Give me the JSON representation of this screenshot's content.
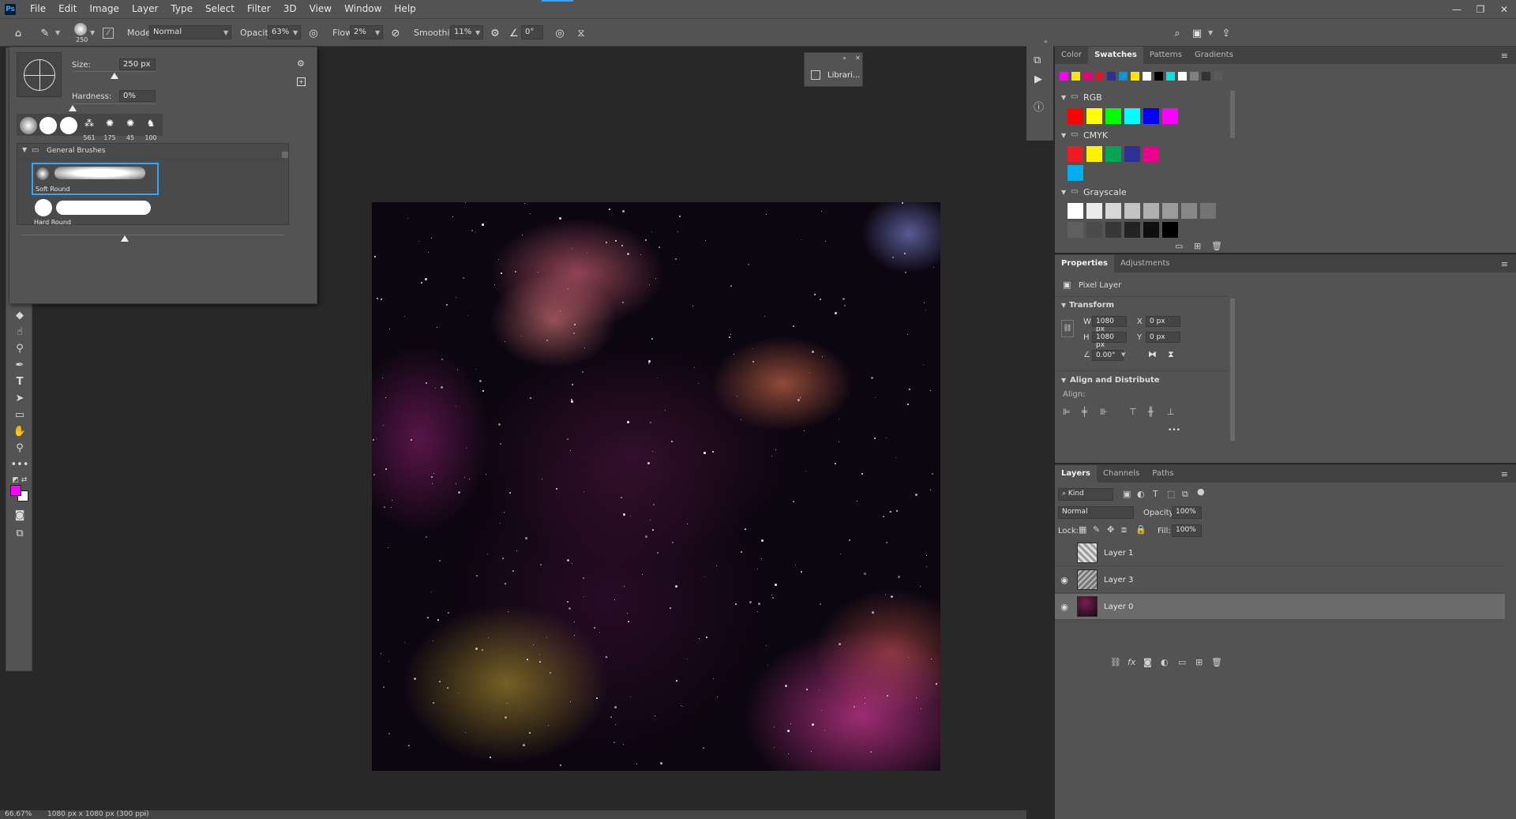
{
  "app": {
    "logo": "Ps"
  },
  "menu": [
    "File",
    "Edit",
    "Image",
    "Layer",
    "Type",
    "Select",
    "Filter",
    "3D",
    "View",
    "Window",
    "Help"
  ],
  "window_controls": {
    "minimize": "—",
    "restore": "❐",
    "close": "✕"
  },
  "options": {
    "brush_size": "250",
    "mode_label": "Mode:",
    "mode_value": "Normal",
    "opacity_label": "Opacity:",
    "opacity_value": "63%",
    "flow_label": "Flow:",
    "flow_value": "2%",
    "smoothing_label": "Smoothing:",
    "smoothing_value": "11%",
    "angle_value": "0°"
  },
  "brush_popup": {
    "size_label": "Size:",
    "size_value": "250 px",
    "size_fraction": 0.5,
    "hardness_label": "Hardness:",
    "hardness_value": "0%",
    "hardness_fraction": 0.0,
    "recent_presets": [
      "",
      "",
      "",
      "561",
      "175",
      "45",
      "100"
    ],
    "group_name": "General Brushes",
    "brushes": [
      {
        "name": "Soft Round",
        "selected": true
      },
      {
        "name": "Hard Round",
        "selected": false
      }
    ]
  },
  "libraries": {
    "label": "Librari..."
  },
  "swatches_panel": {
    "tabs": [
      "Color",
      "Swatches",
      "Patterns",
      "Gradients"
    ],
    "active_tab": "Swatches",
    "recent": [
      "#ff00ff",
      "#ffe600",
      "#e6007e",
      "#e0142a",
      "#2e3192",
      "#0098da",
      "#ffe600",
      "#ffffff",
      "#000000",
      "#00e6e6",
      "#ffffff",
      "#808080",
      "#333333",
      "#5a5a5a"
    ],
    "groups": [
      {
        "name": "RGB",
        "colors": [
          "#ff0000",
          "#ffff00",
          "#00ff00",
          "#00ffff",
          "#0000ff",
          "#ff00ff"
        ]
      },
      {
        "name": "CMYK",
        "colors": [
          "#ed1c24",
          "#fff200",
          "#00a651",
          "#2e3192",
          "#ec008c",
          "#00aeef"
        ]
      },
      {
        "name": "Grayscale",
        "colors": [
          "#ffffff",
          "#ebebeb",
          "#d7d7d7",
          "#c3c3c3",
          "#afafaf",
          "#9b9b9b",
          "#878787",
          "#737373",
          "#5f5f5f",
          "#4b4b4b",
          "#373737",
          "#232323",
          "#0f0f0f",
          "#000000"
        ]
      }
    ]
  },
  "properties_panel": {
    "tabs": [
      "Properties",
      "Adjustments"
    ],
    "active_tab": "Properties",
    "layer_type": "Pixel Layer",
    "transform_title": "Transform",
    "w_label": "W",
    "w_value": "1080 px",
    "h_label": "H",
    "h_value": "1080 px",
    "x_label": "X",
    "x_value": "0 px",
    "y_label": "Y",
    "y_value": "0 px",
    "angle_value": "0.00°",
    "align_title": "Align and Distribute",
    "align_label": "Align:",
    "more": "•••"
  },
  "layers_panel": {
    "tabs": [
      "Layers",
      "Channels",
      "Paths"
    ],
    "active_tab": "Layers",
    "filter_label": "Kind",
    "blend_mode": "Normal",
    "opacity_label": "Opacity:",
    "opacity_value": "100%",
    "lock_label": "Lock:",
    "fill_label": "Fill:",
    "fill_value": "100%",
    "layers": [
      {
        "name": "Layer 1",
        "visible": false,
        "selected": false
      },
      {
        "name": "Layer 3",
        "visible": true,
        "selected": false
      },
      {
        "name": "Layer 0",
        "visible": true,
        "selected": true
      }
    ]
  },
  "status": {
    "zoom": "66.67%",
    "doc_info": "1080 px x 1080 px (300 ppi)",
    "arrow": "›"
  },
  "colors": {
    "foreground": "#ff00ff",
    "background": "#ffffff",
    "accent_select": "#31a8ff"
  }
}
